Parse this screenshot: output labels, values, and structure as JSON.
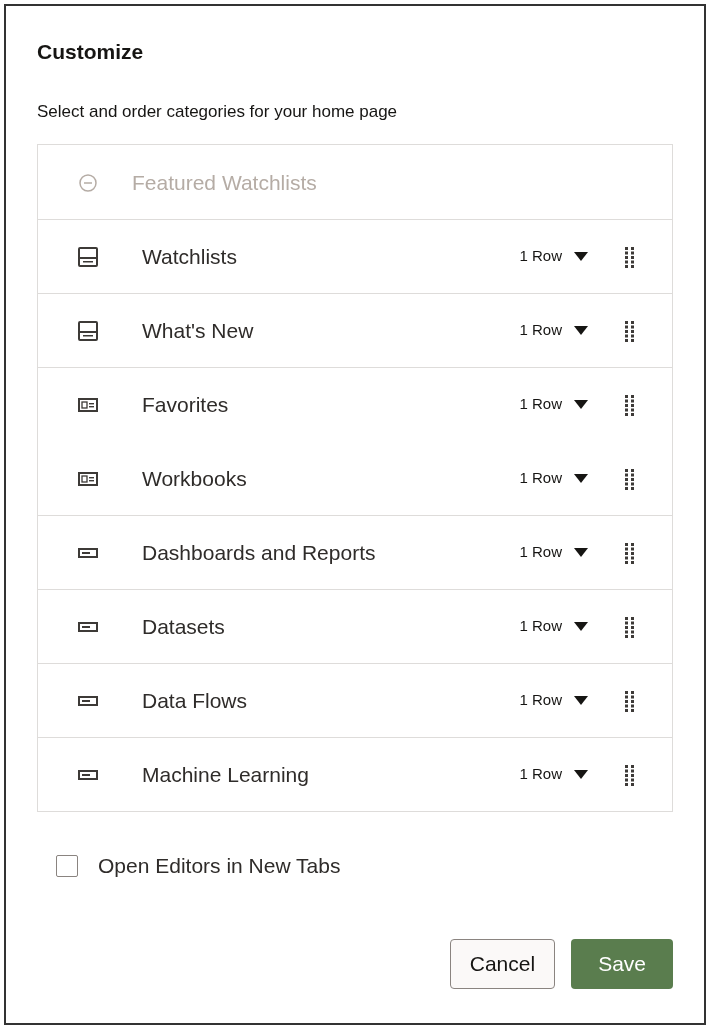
{
  "dialog": {
    "title": "Customize",
    "subtitle": "Select and order categories for your home page"
  },
  "categories": [
    {
      "kind": "removed",
      "label": "Featured Watchlists",
      "disabled": true,
      "divider": false
    },
    {
      "kind": "panel",
      "label": "Watchlists",
      "rows": "1 Row",
      "disabled": false,
      "divider": true
    },
    {
      "kind": "panel",
      "label": "What's New",
      "rows": "1 Row",
      "disabled": false,
      "divider": true
    },
    {
      "kind": "card",
      "label": "Favorites",
      "rows": "1 Row",
      "disabled": false,
      "divider": true
    },
    {
      "kind": "card",
      "label": "Workbooks",
      "rows": "1 Row",
      "disabled": false,
      "divider": false
    },
    {
      "kind": "bar",
      "label": "Dashboards and Reports",
      "rows": "1 Row",
      "disabled": false,
      "divider": true
    },
    {
      "kind": "bar",
      "label": "Datasets",
      "rows": "1 Row",
      "disabled": false,
      "divider": true
    },
    {
      "kind": "bar",
      "label": "Data Flows",
      "rows": "1 Row",
      "disabled": false,
      "divider": true
    },
    {
      "kind": "bar",
      "label": "Machine Learning",
      "rows": "1 Row",
      "disabled": false,
      "divider": true
    }
  ],
  "open_in_new_tabs": {
    "label": "Open Editors in New Tabs",
    "checked": false
  },
  "buttons": {
    "cancel": "Cancel",
    "save": "Save"
  }
}
